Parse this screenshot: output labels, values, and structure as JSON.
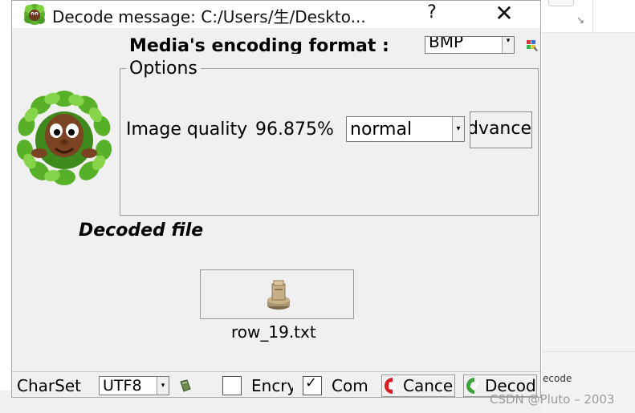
{
  "window": {
    "title": "Decode message: C:/Users/生/Deskto...",
    "help_label": "?",
    "close_label": "✕"
  },
  "format": {
    "label": "Media's encoding format :",
    "selected": "BMP",
    "arrow": "▾"
  },
  "options": {
    "legend": "Options",
    "image_quality_label": "Image quality",
    "image_quality_value": "96.875%",
    "mode_selected": "normal",
    "advance_label": "dvance"
  },
  "decoded": {
    "label": "Decoded file",
    "file_name": "row_19.txt"
  },
  "footer": {
    "charset_label": "CharSet",
    "charset_selected": "UTF8",
    "encrypt_label": "Encry",
    "encrypt_checked": false,
    "compress_label": "Com",
    "compress_checked": true,
    "check_mark": "✓",
    "cancel_label": "Cance",
    "decode_label": "Decod"
  },
  "background": {
    "decode_text": "ecode"
  },
  "watermark": "CSDN @Pluto – 2003",
  "colors": {
    "dialog_bg": "#f0f0f0",
    "cancel_icon": "#d42020",
    "decode_icon": "#3aa43a"
  }
}
